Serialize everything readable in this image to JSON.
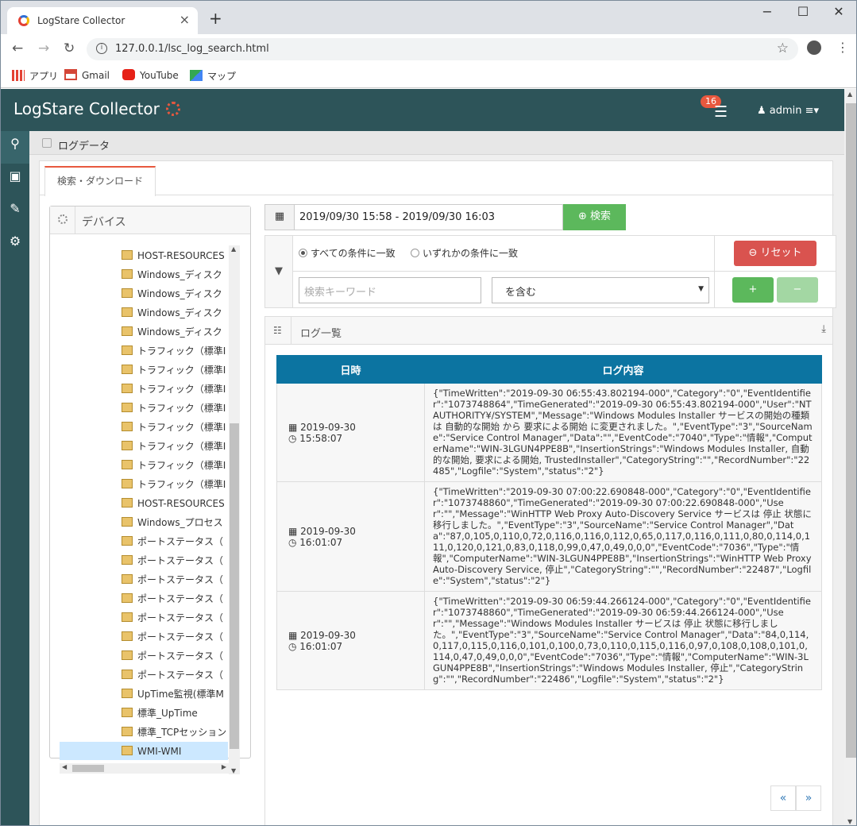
{
  "browser": {
    "tab_title": "LogStare Collector",
    "url": "127.0.0.1/lsc_log_search.html",
    "bookmarks": [
      {
        "label": "アプリ",
        "icon": "apps-grid-icon"
      },
      {
        "label": "Gmail",
        "icon": "gmail-icon"
      },
      {
        "label": "YouTube",
        "icon": "youtube-icon"
      },
      {
        "label": "マップ",
        "icon": "maps-icon"
      }
    ]
  },
  "header": {
    "logo": "LogStare Collector",
    "notification_count": "16",
    "user": "admin"
  },
  "breadcrumb": "ログデータ",
  "tab_label": "検索・ダウンロード",
  "devices": {
    "title": "デバイス",
    "items": [
      "HOST-RESOURCES",
      "Windows_ディスク",
      "Windows_ディスク",
      "Windows_ディスク",
      "Windows_ディスク",
      "トラフィック（標準I",
      "トラフィック（標準I",
      "トラフィック（標準I",
      "トラフィック（標準I",
      "トラフィック（標準I",
      "トラフィック（標準I",
      "トラフィック（標準I",
      "トラフィック（標準I",
      "HOST-RESOURCES",
      "Windows_プロセス",
      "ポートステータス（",
      "ポートステータス（",
      "ポートステータス（",
      "ポートステータス（",
      "ポートステータス（",
      "ポートステータス（",
      "ポートステータス（",
      "ポートステータス（",
      "UpTime監視(標準M",
      "標準_UpTime",
      "標準_TCPセッション",
      "WMI-WMI"
    ],
    "selected": "WMI-WMI"
  },
  "search": {
    "date_range": "2019/09/30 15:58 - 2019/09/30 16:03",
    "search_button": "検索",
    "match_all": "すべての条件に一致",
    "match_any": "いずれかの条件に一致",
    "reset_button": "リセット",
    "keyword_placeholder": "検索キーワード",
    "operator": "を含む",
    "add_button": "+",
    "remove_button": "−"
  },
  "log": {
    "title": "ログ一覧",
    "columns": [
      "日時",
      "ログ内容"
    ],
    "rows": [
      {
        "date": "2019-09-30",
        "time": "15:58:07",
        "content": "{\"TimeWritten\":\"2019-09-30 06:55:43.802194-000\",\"Category\":\"0\",\"EventIdentifier\":\"1073748864\",\"TimeGenerated\":\"2019-09-30 06:55:43.802194-000\",\"User\":\"NT AUTHORITY¥/SYSTEM\",\"Message\":\"Windows Modules Installer サービスの開始の種類は 自動的な開始 から 要求による開始 に変更されました。\",\"EventType\":\"3\",\"SourceName\":\"Service Control Manager\",\"Data\":\"\",\"EventCode\":\"7040\",\"Type\":\"情報\",\"ComputerName\":\"WIN-3LGUN4PPE8B\",\"InsertionStrings\":\"Windows Modules Installer, 自動的な開始, 要求による開始, TrustedInstaller\",\"CategoryString\":\"\",\"RecordNumber\":\"22485\",\"Logfile\":\"System\",\"status\":\"2\"}"
      },
      {
        "date": "2019-09-30",
        "time": "16:01:07",
        "content": "{\"TimeWritten\":\"2019-09-30 07:00:22.690848-000\",\"Category\":\"0\",\"EventIdentifier\":\"1073748860\",\"TimeGenerated\":\"2019-09-30 07:00:22.690848-000\",\"User\":\"\",\"Message\":\"WinHTTP Web Proxy Auto-Discovery Service サービスは 停止 状態に移行しました。\",\"EventType\":\"3\",\"SourceName\":\"Service Control Manager\",\"Data\":\"87,0,105,0,110,0,72,0,116,0,116,0,112,0,65,0,117,0,116,0,111,0,80,0,114,0,111,0,120,0,121,0,83,0,118,0,99,0,47,0,49,0,0,0\",\"EventCode\":\"7036\",\"Type\":\"情報\",\"ComputerName\":\"WIN-3LGUN4PPE8B\",\"InsertionStrings\":\"WinHTTP Web Proxy Auto-Discovery Service, 停止\",\"CategoryString\":\"\",\"RecordNumber\":\"22487\",\"Logfile\":\"System\",\"status\":\"2\"}"
      },
      {
        "date": "2019-09-30",
        "time": "16:01:07",
        "content": "{\"TimeWritten\":\"2019-09-30 06:59:44.266124-000\",\"Category\":\"0\",\"EventIdentifier\":\"1073748860\",\"TimeGenerated\":\"2019-09-30 06:59:44.266124-000\",\"User\":\"\",\"Message\":\"Windows Modules Installer サービスは 停止 状態に移行しました。\",\"EventType\":\"3\",\"SourceName\":\"Service Control Manager\",\"Data\":\"84,0,114,0,117,0,115,0,116,0,101,0,100,0,73,0,110,0,115,0,116,0,97,0,108,0,108,0,101,0,114,0,47,0,49,0,0,0\",\"EventCode\":\"7036\",\"Type\":\"情報\",\"ComputerName\":\"WIN-3LGUN4PPE8B\",\"InsertionStrings\":\"Windows Modules Installer, 停止\",\"CategoryString\":\"\",\"RecordNumber\":\"22486\",\"Logfile\":\"System\",\"status\":\"2\"}"
      }
    ],
    "prev": "«",
    "next": "»"
  },
  "colors": {
    "header": "#2d5459",
    "accent": "#e8583e",
    "table_head": "#0c74a1",
    "success": "#5cb85c",
    "danger": "#d9534f"
  }
}
